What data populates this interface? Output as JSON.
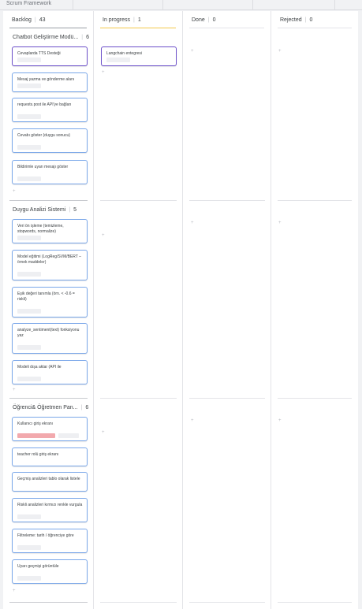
{
  "app": {
    "title": "Scrum Framework"
  },
  "columns": [
    {
      "name": "Backlog",
      "count": "43"
    },
    {
      "name": "In progress",
      "count": "1"
    },
    {
      "name": "Done",
      "count": "0"
    },
    {
      "name": "Rejected",
      "count": "0"
    }
  ],
  "groups": [
    {
      "title": "Chatbot Geliştirme Modü...",
      "count": "6",
      "backlog_cards": [
        {
          "text": "Cevaplarda TTS Desteği"
        },
        {
          "text": "Mesaj yazma ve gönderme alanı"
        },
        {
          "text": "requests.post ile API'ye bağlan"
        },
        {
          "text": "Cevabı göster (duygu sonucu)"
        },
        {
          "text": "Bildirimle uyarı mesajı göster"
        }
      ],
      "inprogress_cards": [
        {
          "text": "Langchain entegresi"
        }
      ]
    },
    {
      "title": "Duygu Analizi Sistemi",
      "count": "5",
      "backlog_cards": [
        {
          "text": "Veri ön işleme (temizleme, stopwords, normalize)"
        },
        {
          "text": "Model eğitimi (LogReg/SVM/BERT – örnek maddeler)"
        },
        {
          "text": "Eşik değeri tanımla (örn. < -0.6 = riskli)"
        },
        {
          "text": "analyze_sentiment(text) fonksiyonu yaz"
        },
        {
          "text": "Modeli dışa aktar (API ile"
        }
      ]
    },
    {
      "title": "Öğrenci& Öğretmen Pan...",
      "count": "6",
      "backlog_cards": [
        {
          "text": "Kullanıcı giriş ekranı"
        },
        {
          "text": "teacher rolü giriş ekranı"
        },
        {
          "text": "Geçmiş analizleri tablo olarak listele"
        },
        {
          "text": "Riskli analizleri kırmızı renkle vurgula"
        },
        {
          "text": "Filtreleme: tarih / öğrenciye göre"
        },
        {
          "text": "Uyarı geçmişi görüntüle"
        }
      ]
    }
  ],
  "colors": {
    "accent": "#7aa7e9",
    "selected_border": "#6b4fc9",
    "inprogress_underline": "#f2c94c",
    "risk_bar": "#f2a9ad"
  },
  "add_symbol": "+"
}
